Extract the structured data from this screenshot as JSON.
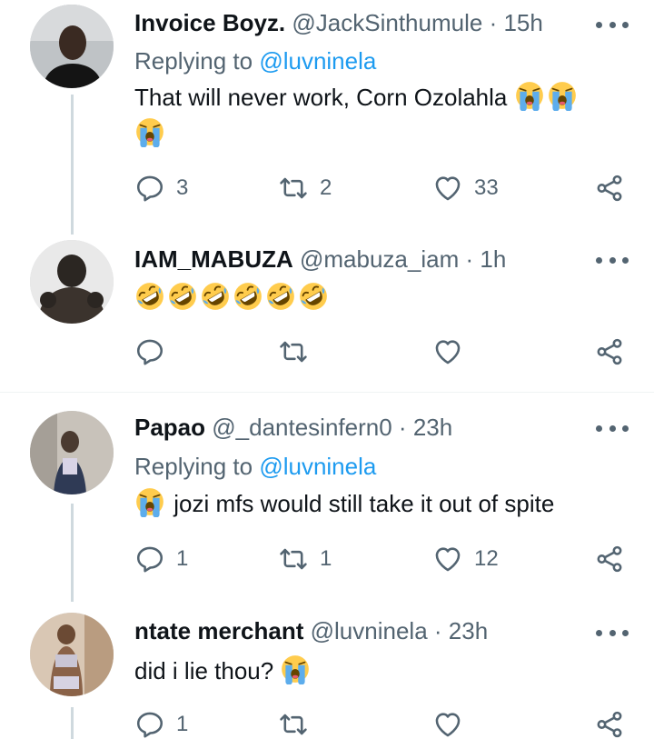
{
  "tweets": [
    {
      "name": "Invoice Boyz.",
      "handle": "@JackSinthumule",
      "dot": "·",
      "time": "15h",
      "replying_prefix": "Replying to",
      "replying_to": "@luvninela",
      "text": "That will never work, Corn Ozolahla",
      "emoji": "loudly-crying-face x3",
      "replies": "3",
      "retweets": "2",
      "likes": "33"
    },
    {
      "name": "IAM_MABUZA",
      "handle": "@mabuza_iam",
      "dot": "·",
      "time": "1h",
      "text": "",
      "emoji": "rolling-on-floor-laughing x6",
      "replies": "",
      "retweets": "",
      "likes": ""
    },
    {
      "name": "Papao",
      "handle": "@_dantesinfern0",
      "dot": "·",
      "time": "23h",
      "replying_prefix": "Replying to",
      "replying_to": "@luvninela",
      "text": "jozi mfs would still take it out of spite",
      "emoji": "loudly-crying-face x1",
      "replies": "1",
      "retweets": "1",
      "likes": "12"
    },
    {
      "name": "ntate merchant",
      "handle": "@luvninela",
      "dot": "·",
      "time": "23h",
      "text": "did i lie thou?",
      "emoji": "loudly-crying-face x1",
      "replies": "1",
      "retweets": "",
      "likes": ""
    }
  ],
  "colors": {
    "name": "#0f1419",
    "secondary": "#536471",
    "link": "#1d9bf0",
    "thread_line": "#cfd9de",
    "divider": "#eff3f4"
  },
  "icons": [
    "reply-icon",
    "retweet-icon",
    "like-icon",
    "share-icon",
    "more-icon"
  ]
}
